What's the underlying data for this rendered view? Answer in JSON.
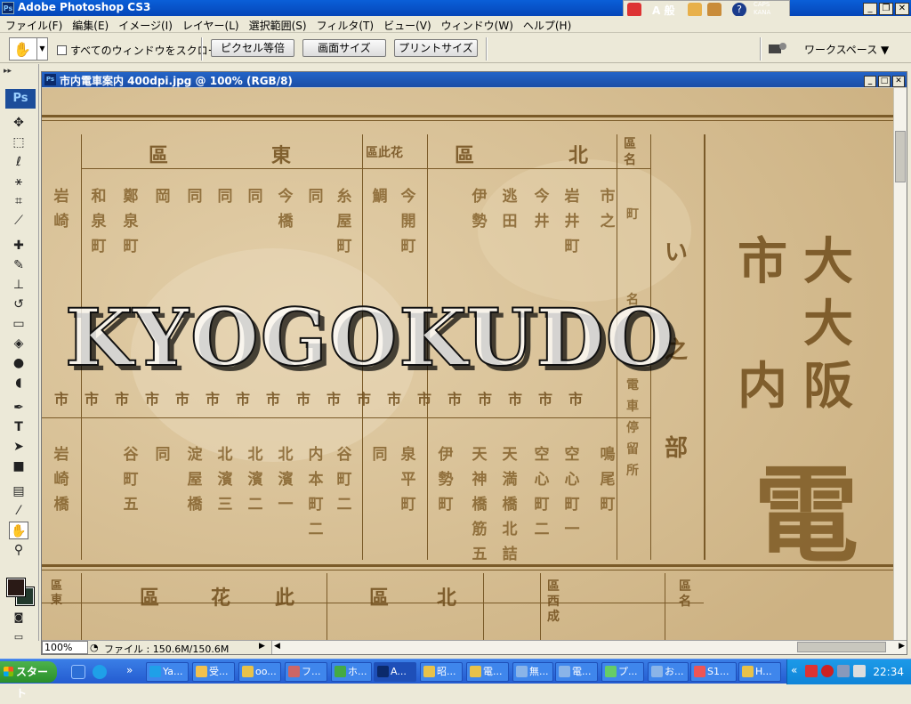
{
  "app": {
    "title": "Adobe Photoshop CS3",
    "logo": "Ps"
  },
  "ime": {
    "mode": "A 般",
    "caps": "CAPS",
    "kana": "KANA"
  },
  "menu": [
    "ファイル(F)",
    "編集(E)",
    "イメージ(I)",
    "レイヤー(L)",
    "選択範囲(S)",
    "フィルタ(T)",
    "ビュー(V)",
    "ウィンドウ(W)",
    "ヘルプ(H)"
  ],
  "options": {
    "scroll_all_label": "すべてのウィンドウをスクロール",
    "actual_pixels": "ピクセル等倍",
    "fit_screen": "画面サイズ",
    "print_size": "プリントサイズ",
    "workspace": "ワークスペース ▼"
  },
  "document": {
    "title": "市内電車案内 400dpi.jpg @ 100% (RGB/8)",
    "zoom": "100%",
    "file_info": "ファイル : 150.6M/150.6M",
    "watermark": "KYOGOKUDO"
  },
  "scan": {
    "header_top": [
      "區",
      "東",
      "區此花",
      "區",
      "北",
      "區名"
    ],
    "big_title": [
      "大",
      "大",
      "阪",
      "市",
      "内"
    ],
    "big_char": "電",
    "side_label": [
      "い",
      "之",
      "部"
    ],
    "bottom_header": [
      "區東",
      "區",
      "花",
      "此",
      "區",
      "北",
      "區西成",
      "區名"
    ],
    "columns_top": [
      "市之",
      "岩井町",
      "今井",
      "逃田",
      "伊勢",
      "今開町",
      "鯛",
      "糸屋町",
      "同",
      "今橋",
      "同",
      "同",
      "同",
      "岡",
      "鄭泉町",
      "和泉町",
      "岩崎"
    ],
    "columns_bottom": [
      "鳴尾町",
      "空心町一",
      "空心町二",
      "天満橋北詰",
      "天神橋筋五",
      "伊勢町",
      "泉平町",
      "同",
      "谷町二",
      "内本町二",
      "北濱一",
      "北濱二",
      "北濱三",
      "淀屋橋",
      "同",
      "谷町五",
      "岩崎橋"
    ]
  },
  "taskbar": {
    "start": "スタート",
    "tasks": [
      "Ya...",
      "受...",
      "oo...",
      "フ...",
      "ホ...",
      "A...",
      "昭...",
      "電...",
      "無...",
      "電...",
      "プ...",
      "お...",
      "S1...",
      "H..."
    ],
    "clock": "22:34"
  }
}
